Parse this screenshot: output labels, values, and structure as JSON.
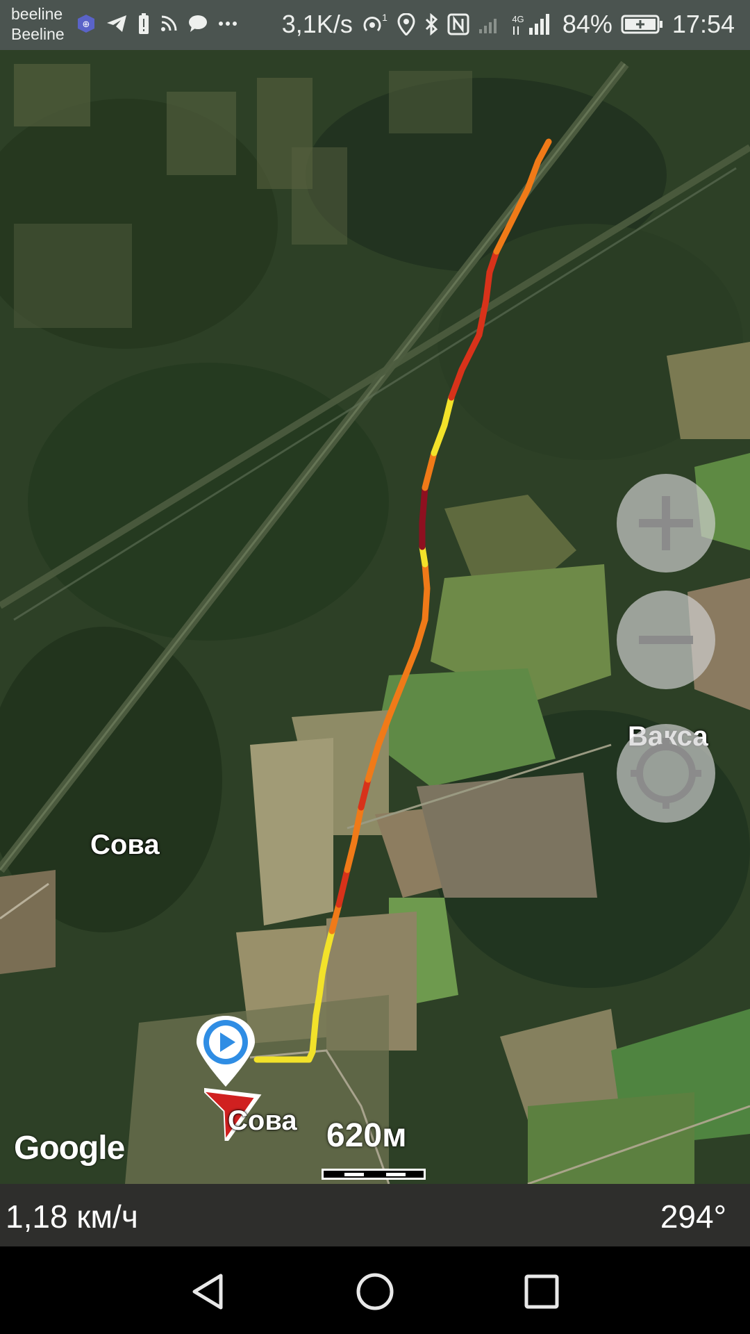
{
  "status_bar": {
    "carrier_line1": "beeline",
    "carrier_line2": "Beeline",
    "network_speed": "3,1K/s",
    "hotspot_badge": "1",
    "network_type": "4G",
    "battery": "84%",
    "time": "17:54",
    "icons": [
      "shield-app-icon",
      "telegram-icon",
      "battery-alert-icon",
      "rss-icon",
      "chat-icon",
      "more-icon",
      "hotspot-icon",
      "location-icon",
      "bluetooth-icon",
      "nfc-icon",
      "signal-icon",
      "battery-icon"
    ]
  },
  "map": {
    "type": "satellite",
    "places": [
      {
        "id": "sova-west",
        "label": "Сова"
      },
      {
        "id": "sova-south",
        "label": "Сова"
      },
      {
        "id": "vaksa",
        "label": "Вакса"
      }
    ],
    "track_colors": {
      "slow": "#8e1020",
      "medium": "#d8321a",
      "fast": "#f07a18",
      "fastest": "#f2e22a"
    },
    "controls": [
      {
        "id": "zoom-in",
        "icon": "plus-icon"
      },
      {
        "id": "zoom-out",
        "icon": "minus-icon"
      },
      {
        "id": "my-location",
        "icon": "crosshair-icon"
      }
    ],
    "markers": [
      "start-marker-icon",
      "current-position-arrow-icon"
    ],
    "attribution": "Google",
    "scale": "620м"
  },
  "info_bar": {
    "speed": "1,18 км/ч",
    "heading": "294°"
  },
  "nav_bar": {
    "buttons": [
      {
        "id": "back",
        "icon": "back-triangle-icon"
      },
      {
        "id": "home",
        "icon": "home-circle-icon"
      },
      {
        "id": "recents",
        "icon": "recents-square-icon"
      }
    ]
  }
}
